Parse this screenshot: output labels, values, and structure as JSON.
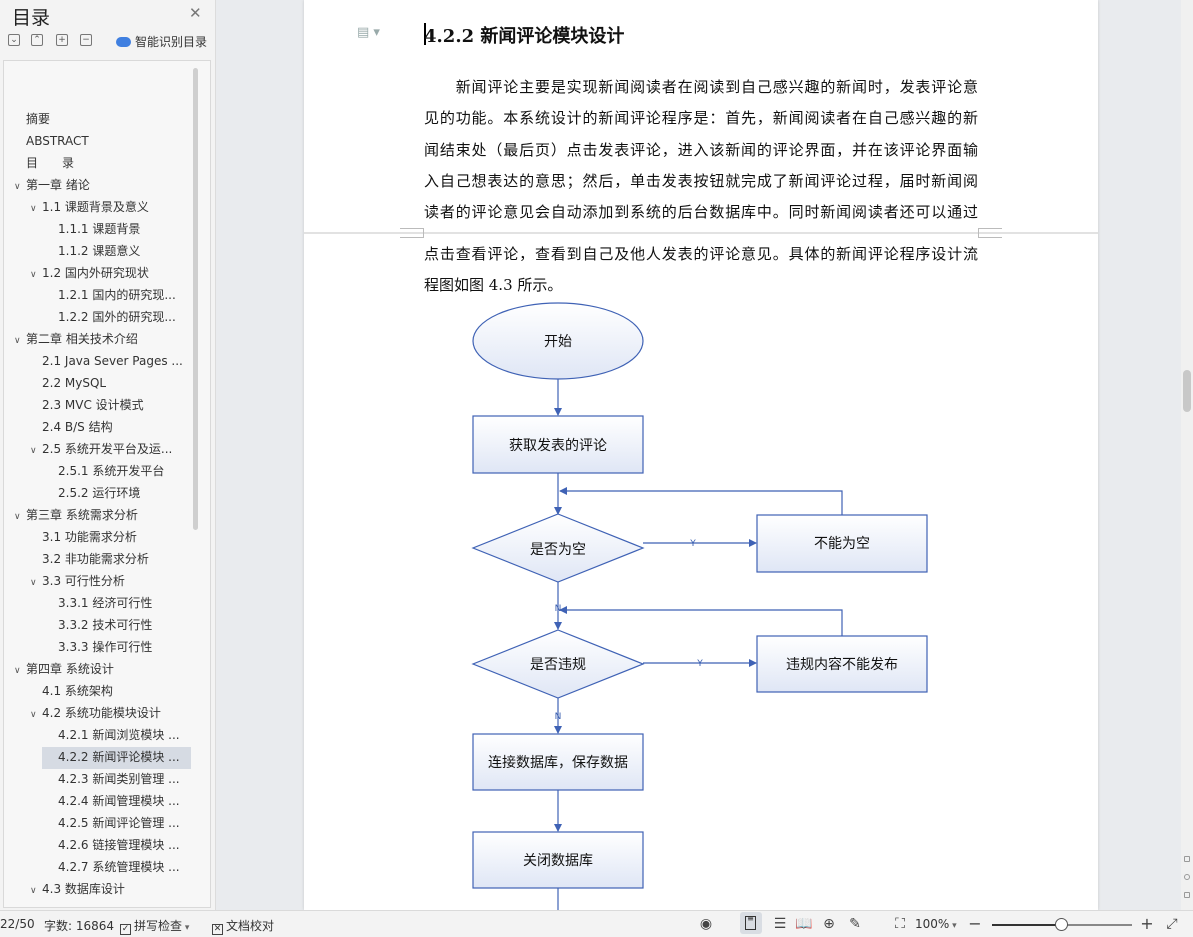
{
  "toc": {
    "title": "目录",
    "smart_label": "智能识别目录",
    "tools": [
      "⌄",
      "⌃",
      "+",
      "−"
    ],
    "items": [
      {
        "label": "摘要",
        "level": 0,
        "arrow": false
      },
      {
        "label": "ABSTRACT",
        "level": 0,
        "arrow": false
      },
      {
        "label": "目　　录",
        "level": 0,
        "arrow": false
      },
      {
        "label": "第一章  绪论",
        "level": 0,
        "arrow": true
      },
      {
        "label": "1.1  课题背景及意义",
        "level": 1,
        "arrow": true
      },
      {
        "label": "1.1.1  课题背景",
        "level": 2,
        "arrow": false
      },
      {
        "label": "1.1.2  课题意义",
        "level": 2,
        "arrow": false
      },
      {
        "label": "1.2  国内外研究现状",
        "level": 1,
        "arrow": true
      },
      {
        "label": "1.2.1  国内的研究现...",
        "level": 2,
        "arrow": false
      },
      {
        "label": "1.2.2  国外的研究现...",
        "level": 2,
        "arrow": false
      },
      {
        "label": "第二章  相关技术介绍",
        "level": 0,
        "arrow": true
      },
      {
        "label": "2.1 Java Sever Pages ...",
        "level": 1,
        "arrow": false
      },
      {
        "label": "2.2 MySQL",
        "level": 1,
        "arrow": false
      },
      {
        "label": "2.3 MVC 设计模式",
        "level": 1,
        "arrow": false
      },
      {
        "label": "2.4 B/S 结构",
        "level": 1,
        "arrow": false
      },
      {
        "label": "2.5 系统开发平台及运...",
        "level": 1,
        "arrow": true
      },
      {
        "label": "2.5.1  系统开发平台",
        "level": 2,
        "arrow": false
      },
      {
        "label": "2.5.2  运行环境",
        "level": 2,
        "arrow": false
      },
      {
        "label": "第三章  系统需求分析",
        "level": 0,
        "arrow": true
      },
      {
        "label": "3.1  功能需求分析",
        "level": 1,
        "arrow": false
      },
      {
        "label": "3.2  非功能需求分析",
        "level": 1,
        "arrow": false
      },
      {
        "label": "3.3  可行性分析",
        "level": 1,
        "arrow": true
      },
      {
        "label": "3.3.1  经济可行性",
        "level": 2,
        "arrow": false
      },
      {
        "label": "3.3.2  技术可行性",
        "level": 2,
        "arrow": false
      },
      {
        "label": "3.3.3  操作可行性",
        "level": 2,
        "arrow": false
      },
      {
        "label": "第四章  系统设计",
        "level": 0,
        "arrow": true
      },
      {
        "label": "4.1  系统架构",
        "level": 1,
        "arrow": false
      },
      {
        "label": "4.2  系统功能模块设计",
        "level": 1,
        "arrow": true
      },
      {
        "label": "4.2.1  新闻浏览模块 ...",
        "level": 2,
        "arrow": false
      },
      {
        "label": "4.2.2  新闻评论模块 ...",
        "level": 2,
        "arrow": false,
        "selected": true
      },
      {
        "label": "4.2.3  新闻类别管理 ...",
        "level": 2,
        "arrow": false
      },
      {
        "label": "4.2.4  新闻管理模块 ...",
        "level": 2,
        "arrow": false
      },
      {
        "label": "4.2.5  新闻评论管理 ...",
        "level": 2,
        "arrow": false
      },
      {
        "label": "4.2.6  链接管理模块 ...",
        "level": 2,
        "arrow": false
      },
      {
        "label": "4.2.7  系统管理模块 ...",
        "level": 2,
        "arrow": false
      },
      {
        "label": "4.3  数据库设计",
        "level": 1,
        "arrow": true
      }
    ]
  },
  "doc": {
    "heading": "4.2.2  新闻评论模块设计",
    "lines": [
      "　　新闻评论主要是实现新闻阅读者在阅读到自己感兴趣的新闻时，发表评论意",
      "见的功能。本系统设计的新闻评论程序是：首先，新闻阅读者在自己感兴趣的新",
      "闻结束处（最后页）点击发表评论，进入该新闻的评论界面，并在该评论界面输",
      "入自己想表达的意思；然后，单击发表按钮就完成了新闻评论过程，届时新闻阅",
      "读者的评论意见会自动添加到系统的后台数据库中。同时新闻阅读者还可以通过",
      "点击查看评论，查看到自己及他人发表的评论意见。具体的新闻评论程序设计流",
      "程图如图 4.3 所示。"
    ],
    "flowchart": {
      "start": "开始",
      "get_comment": "获取发表的评论",
      "is_empty": "是否为空",
      "cannot_empty": "不能为空",
      "is_violation": "是否违规",
      "violation_msg": "违规内容不能发布",
      "connect_db": "连接数据库，保存数据",
      "close_db": "关闭数据库",
      "yes": "Y",
      "no": "N"
    }
  },
  "status": {
    "page": "22/50",
    "word_count": "字数: 16864",
    "spell_check": "拼写检查",
    "doc_proof": "文档校对",
    "zoom": "100%",
    "zoom_fraction": 0.5
  },
  "colors": {
    "flow_stroke": "#3f62b5",
    "flow_fill_top": "#ffffff",
    "flow_fill_bottom": "#dfe6f5"
  }
}
